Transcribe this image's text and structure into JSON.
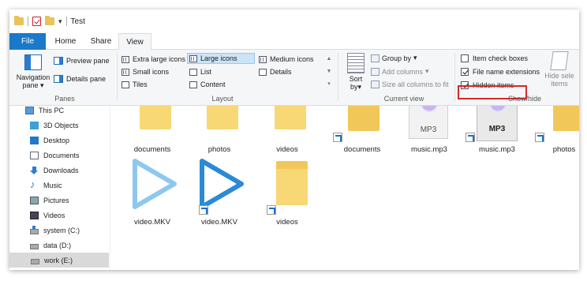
{
  "window": {
    "title": "Test"
  },
  "tabs": [
    {
      "label": "File"
    },
    {
      "label": "Home"
    },
    {
      "label": "Share"
    },
    {
      "label": "View"
    }
  ],
  "ribbon": {
    "panes": {
      "navigation_pane_label_1": "Navigation",
      "navigation_pane_label_2": "pane",
      "preview_pane": "Preview pane",
      "details_pane": "Details pane",
      "group_label": "Panes"
    },
    "layout": {
      "items": [
        {
          "label": "Extra large icons"
        },
        {
          "label": "Large icons",
          "selected": true
        },
        {
          "label": "Medium icons"
        },
        {
          "label": "Small icons"
        },
        {
          "label": "List"
        },
        {
          "label": "Details"
        },
        {
          "label": "Tiles"
        },
        {
          "label": "Content"
        }
      ],
      "group_label": "Layout"
    },
    "current_view": {
      "sort_label_1": "Sort",
      "sort_label_2": "by",
      "group_by": "Group by",
      "add_columns": "Add columns",
      "size_all_columns": "Size all columns to fit",
      "group_label": "Current view"
    },
    "show_hide": {
      "item_check_boxes": {
        "label": "Item check boxes",
        "checked": false
      },
      "file_name_extensions": {
        "label": "File name extensions",
        "checked": true
      },
      "hidden_items": {
        "label": "Hidden items",
        "checked": true
      },
      "hide_selected_1": "Hide sele",
      "hide_selected_2": "items",
      "group_label": "Show/hide",
      "highlight_color": "#d42a2a"
    }
  },
  "nav": {
    "items": [
      {
        "label": "This PC",
        "icon": "computer-icon"
      },
      {
        "label": "3D Objects",
        "icon": "3d-objects-icon"
      },
      {
        "label": "Desktop",
        "icon": "desktop-icon"
      },
      {
        "label": "Documents",
        "icon": "documents-icon"
      },
      {
        "label": "Downloads",
        "icon": "downloads-icon"
      },
      {
        "label": "Music",
        "icon": "music-icon"
      },
      {
        "label": "Pictures",
        "icon": "pictures-icon"
      },
      {
        "label": "Videos",
        "icon": "videos-icon"
      },
      {
        "label": "system (C:)",
        "icon": "system-drive-icon"
      },
      {
        "label": "data (D:)",
        "icon": "drive-icon"
      },
      {
        "label": "work (E:)",
        "icon": "drive-icon",
        "selected": true
      }
    ]
  },
  "files": [
    {
      "name": "documents",
      "type": "folder"
    },
    {
      "name": "photos",
      "type": "folder"
    },
    {
      "name": "videos",
      "type": "folder"
    },
    {
      "name": "documents",
      "type": "folder-shortcut"
    },
    {
      "name": "music.mp3",
      "type": "mp3",
      "thumb_text": "MP3"
    },
    {
      "name": "music.mp3",
      "type": "mp3-shortcut",
      "thumb_text": "MP3"
    },
    {
      "name": "photos",
      "type": "folder-shortcut"
    },
    {
      "name": "video.MKV",
      "type": "video"
    },
    {
      "name": "video.MKV",
      "type": "video-shortcut"
    },
    {
      "name": "videos",
      "type": "folder-shortcut"
    }
  ],
  "colors": {
    "accent": "#1979ca",
    "folder": "#f8d775",
    "play_light": "#8ec8f0",
    "play_dark": "#2b8ad8"
  }
}
